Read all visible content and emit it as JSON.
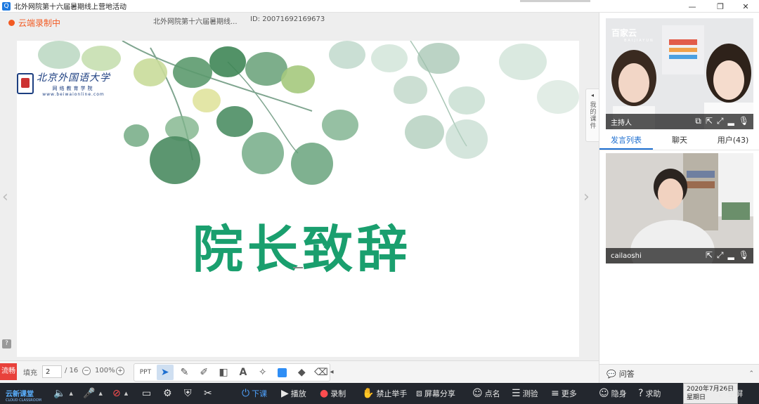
{
  "window": {
    "title": "北外网院第十六届暑期线上营地活动",
    "minimize": "—",
    "maximize": "❐",
    "close": "✕"
  },
  "stage": {
    "recording_label": "云端录制中",
    "course_title": "北外网院第十六届暑期线...",
    "course_id": "ID: 20071692169673",
    "prev_arrow": "‹",
    "next_arrow": "›",
    "side_tab_label": "我的课件",
    "side_tab_arrow": "◂",
    "help_icon": "?"
  },
  "slide": {
    "logo_main": "北京外国语大学",
    "logo_sub": "网络教育学院",
    "logo_url": "www.beiwaionline.com",
    "heading": "院长致辞"
  },
  "whiteboard": {
    "flow_badge": "流畅",
    "fill_label": "填充",
    "page_current": "2",
    "page_total": "/ 16",
    "zoom_out": "−",
    "zoom_level": "100%",
    "zoom_in": "+",
    "tool_ppt": "PPT",
    "collapse_arrow": "◂",
    "accent_color": "#2f8ef5"
  },
  "right_panel": {
    "video1": {
      "brand": "百家云",
      "brand_sub": "BAIJIAYUN",
      "name": "主持人"
    },
    "video2": {
      "name": "cailaoshi"
    },
    "tabs": [
      {
        "label": "发言列表"
      },
      {
        "label": "聊天"
      },
      {
        "label": "用户(43)"
      }
    ],
    "qa_label": "问答",
    "qa_arrow": "⌃"
  },
  "controls": {
    "brand": "云新课堂",
    "brand_sub": "CLOUD CLASSROOM",
    "end_class": "下课",
    "play": "播放",
    "record": "录制",
    "ban_hands": "禁止举手",
    "screen_share": "屏幕分享",
    "roll_call": "点名",
    "quiz": "测验",
    "more": "更多",
    "hide": "隐身",
    "help": "求助",
    "fullscreen": "全屏"
  },
  "clock": {
    "date": "2020年7月26日",
    "weekday": "星期日"
  }
}
